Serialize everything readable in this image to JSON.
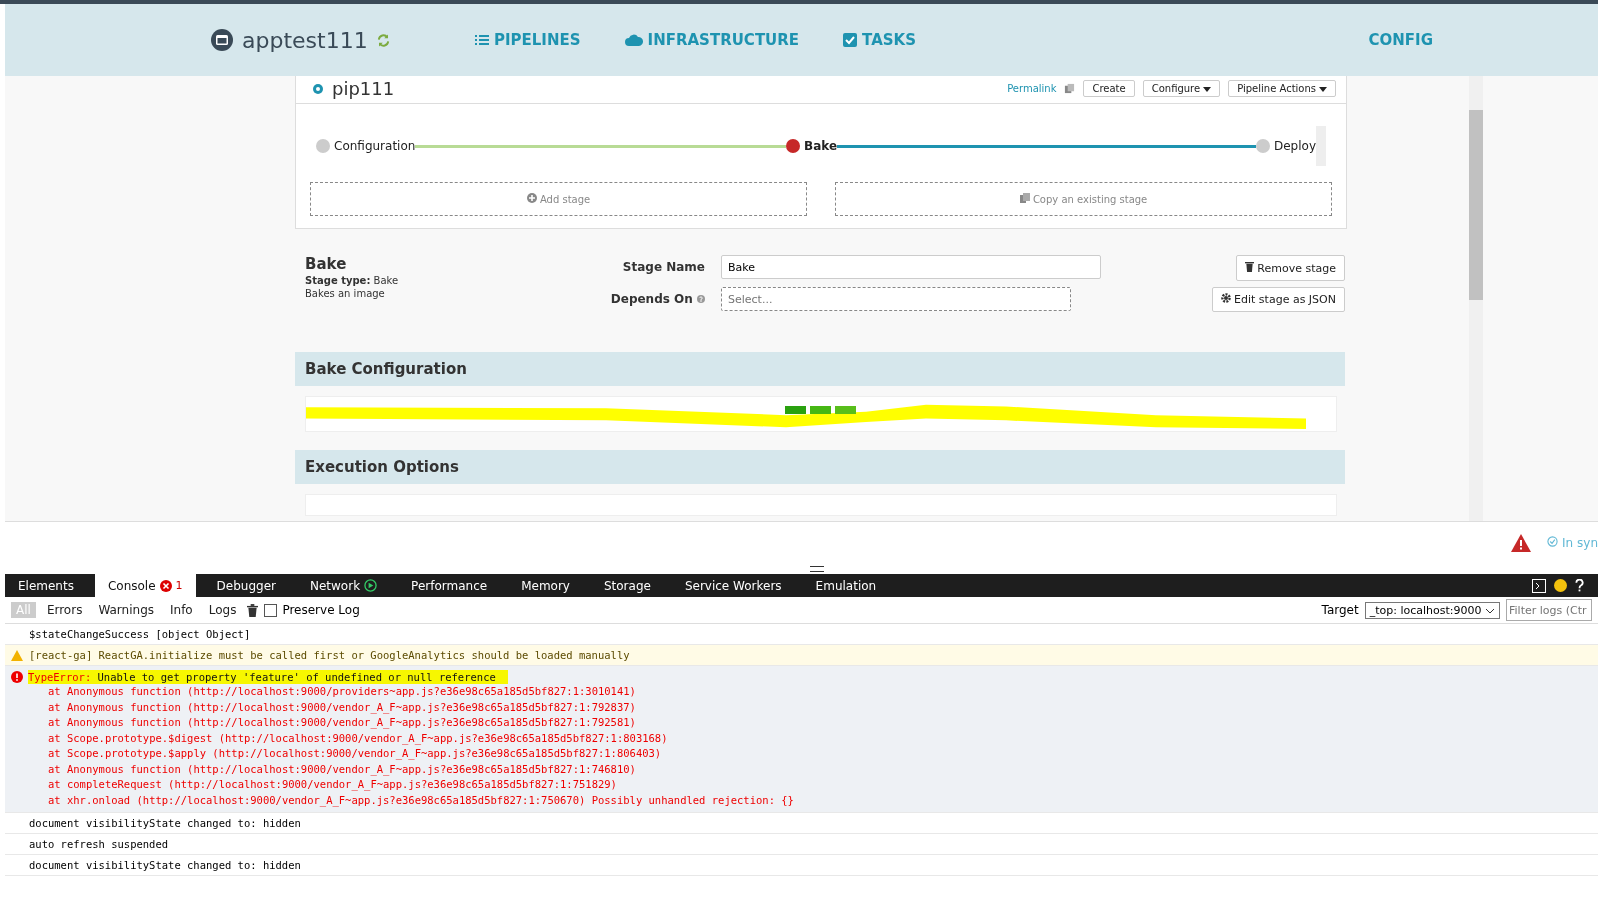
{
  "app": {
    "name": "apptest111"
  },
  "nav": [
    {
      "label": "PIPELINES"
    },
    {
      "label": "INFRASTRUCTURE"
    },
    {
      "label": "TASKS"
    }
  ],
  "config_link": "CONFIG",
  "pipeline": {
    "name": "pip111",
    "permalink": "Permalink",
    "actions": [
      "Create",
      "Configure",
      "Pipeline Actions"
    ]
  },
  "stages": [
    {
      "name": "Configuration",
      "selected": false
    },
    {
      "name": "Bake",
      "selected": true
    },
    {
      "name": "Deploy",
      "selected": false
    }
  ],
  "stage_buttons": [
    "Add stage",
    "Copy an existing stage"
  ],
  "stage": {
    "title": "Bake",
    "type_label": "Stage type:",
    "type": "Bake",
    "description": "Bakes an image",
    "name_label": "Stage Name",
    "name_value": "Bake",
    "depends_label": "Depends On",
    "depends_placeholder": "Select...",
    "buttons": [
      "Remove stage",
      "Edit stage as JSON"
    ]
  },
  "sections": [
    "Bake Configuration",
    "Execution Options"
  ],
  "sync_status": "In syn",
  "devtools": {
    "tabs": [
      {
        "label": "Elements",
        "selected": false
      },
      {
        "label": "Console",
        "selected": true,
        "badge": "1"
      },
      {
        "label": "Debugger",
        "selected": false
      },
      {
        "label": "Network",
        "selected": false
      },
      {
        "label": "Performance",
        "selected": false
      },
      {
        "label": "Memory",
        "selected": false
      },
      {
        "label": "Storage",
        "selected": false
      },
      {
        "label": "Service Workers",
        "selected": false
      },
      {
        "label": "Emulation",
        "selected": false
      }
    ],
    "filters": [
      {
        "label": "All",
        "selected": true
      },
      {
        "label": "Errors",
        "selected": false
      },
      {
        "label": "Warnings",
        "selected": false
      },
      {
        "label": "Info",
        "selected": false
      },
      {
        "label": "Logs",
        "selected": false
      }
    ],
    "preserve_log": {
      "label": "Preserve Log",
      "checked": false
    },
    "target_label": "Target",
    "target_value": "_top: localhost:9000",
    "filter_placeholder": "Filter logs (Ctr"
  },
  "console": [
    {
      "kind": "log",
      "text": "$stateChangeSuccess [object Object]"
    },
    {
      "kind": "warning",
      "text": "[react-ga] ReactGA.initialize must be called first or GoogleAnalytics should be loaded manually"
    },
    {
      "kind": "error",
      "prefix": "TypeError:",
      "text": "Unable to get property 'feature' of undefined or null reference",
      "stack": [
        "at Anonymous function (http://localhost:9000/providers~app.js?e36e98c65a185d5bf827:1:3010141)",
        "at Anonymous function (http://localhost:9000/vendor_A_F~app.js?e36e98c65a185d5bf827:1:792837)",
        "at Anonymous function (http://localhost:9000/vendor_A_F~app.js?e36e98c65a185d5bf827:1:792581)",
        "at Scope.prototype.$digest (http://localhost:9000/vendor_A_F~app.js?e36e98c65a185d5bf827:1:803168)",
        "at Scope.prototype.$apply (http://localhost:9000/vendor_A_F~app.js?e36e98c65a185d5bf827:1:806403)",
        "at Anonymous function (http://localhost:9000/vendor_A_F~app.js?e36e98c65a185d5bf827:1:746810)",
        "at completeRequest (http://localhost:9000/vendor_A_F~app.js?e36e98c65a185d5bf827:1:751829)",
        "at xhr.onload (http://localhost:9000/vendor_A_F~app.js?e36e98c65a185d5bf827:1:750670) Possibly unhandled rejection: {}"
      ]
    },
    {
      "kind": "log",
      "text": "document visibilityState changed to:  hidden"
    },
    {
      "kind": "log",
      "text": "auto refresh suspended"
    },
    {
      "kind": "log",
      "text": "document visibilityState changed to:  hidden"
    }
  ]
}
